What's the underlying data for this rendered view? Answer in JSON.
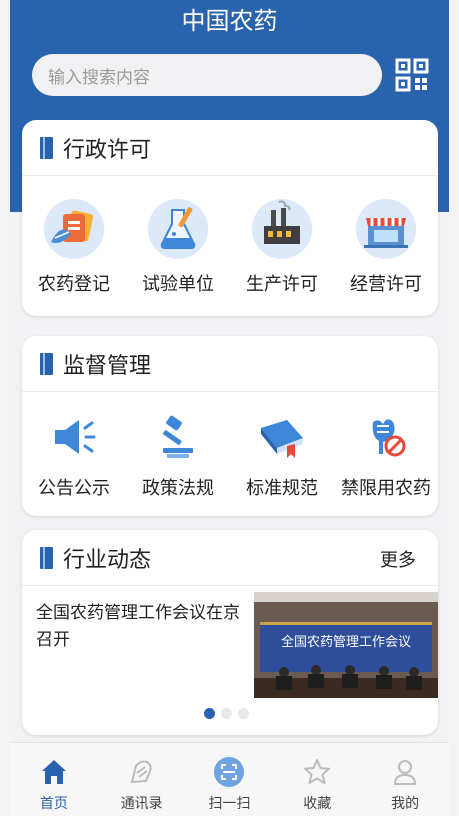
{
  "app": {
    "title": "中国农药"
  },
  "search": {
    "placeholder": "输入搜索内容"
  },
  "colors": {
    "brand": "#2a63ad",
    "icon_blue": "#3d86d8",
    "background": "#f2f2f4"
  },
  "sections": {
    "admin": {
      "title": "行政许可",
      "items": [
        {
          "label": "农药登记",
          "icon": "pesticide-registration-icon"
        },
        {
          "label": "试验单位",
          "icon": "flask-icon"
        },
        {
          "label": "生产许可",
          "icon": "factory-icon"
        },
        {
          "label": "经营许可",
          "icon": "store-icon"
        }
      ]
    },
    "supervision": {
      "title": "监督管理",
      "items": [
        {
          "label": "公告公示",
          "icon": "megaphone-icon"
        },
        {
          "label": "政策法规",
          "icon": "gavel-icon"
        },
        {
          "label": "标准规范",
          "icon": "book-icon"
        },
        {
          "label": "禁限用农药",
          "icon": "prohibited-icon"
        }
      ]
    },
    "news": {
      "title": "行业动态",
      "more": "更多",
      "headline": "全国农药管理工作会议在京召开",
      "image_banner": "全国农药管理工作会议",
      "carousel": {
        "count": 3,
        "active": 0
      }
    }
  },
  "tabbar": [
    {
      "label": "首页",
      "icon": "home-icon",
      "active": true
    },
    {
      "label": "通讯录",
      "icon": "contacts-icon",
      "active": false
    },
    {
      "label": "扫一扫",
      "icon": "scan-icon",
      "active": false
    },
    {
      "label": "收藏",
      "icon": "star-icon",
      "active": false
    },
    {
      "label": "我的",
      "icon": "user-icon",
      "active": false
    }
  ]
}
